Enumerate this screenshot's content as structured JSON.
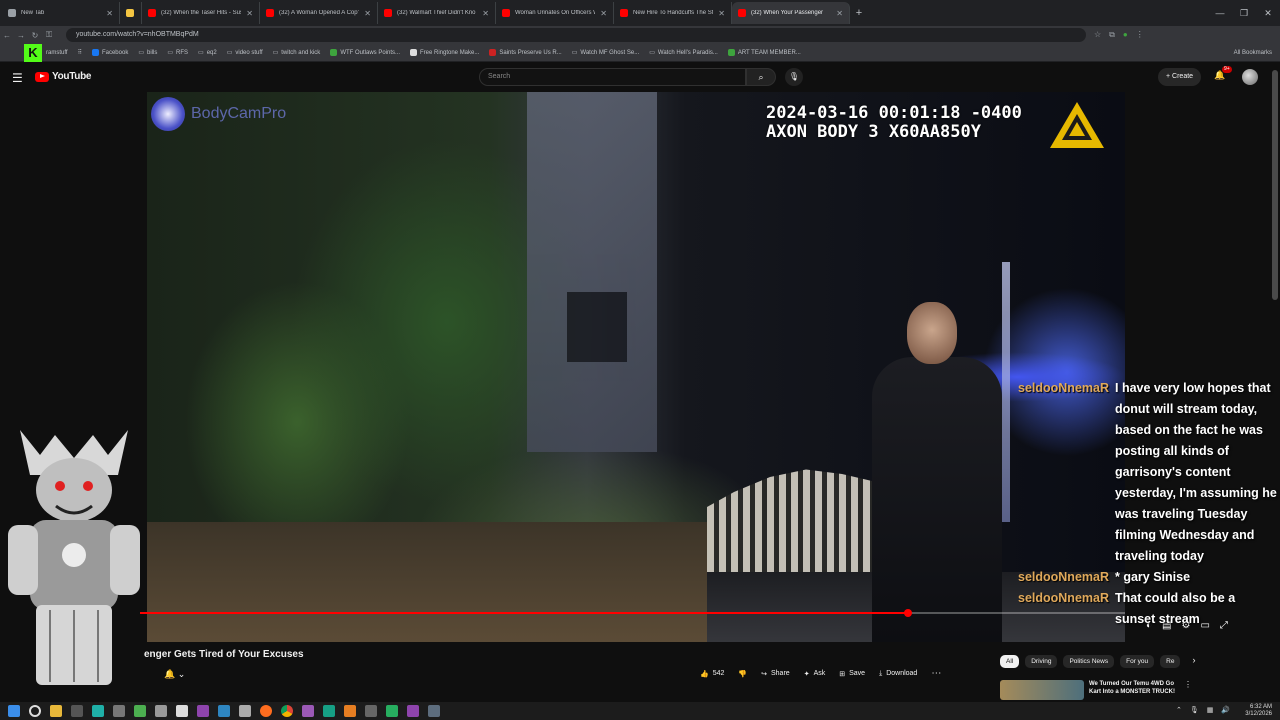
{
  "browser": {
    "tabs": [
      {
        "title": "New Tab",
        "color": "#9aa0a6",
        "active": false
      },
      {
        "title": "",
        "color": "#f4c542",
        "active": false
      },
      {
        "title": "(32) When the Taser Hits - Susp",
        "color": "#ff0000",
        "active": false
      },
      {
        "title": "(32) A Woman Opened A Cop's",
        "color": "#ff0000",
        "active": false
      },
      {
        "title": "(32) Walmart Thief Didn't Kno",
        "color": "#ff0000",
        "active": false
      },
      {
        "title": "Woman Urinates On Officers W",
        "color": "#ff0000",
        "active": false
      },
      {
        "title": "New Hire To Handcuffs The St",
        "color": "#ff0000",
        "active": false
      },
      {
        "title": "(32) When Your Passenger",
        "color": "#ff0000",
        "active": true
      }
    ],
    "tab_close": "✕",
    "new_tab": "+",
    "window_controls": [
      "—",
      "❐",
      "✕"
    ],
    "url": "youtube.com/watch?v=nhOBTMBqPdM",
    "bookmarks": [
      {
        "label": "Facebook",
        "color": "#1877f2"
      },
      {
        "label": "bills",
        "color": "#888"
      },
      {
        "label": "RFS",
        "color": "#888"
      },
      {
        "label": "eq2",
        "color": "#888"
      },
      {
        "label": "video stuff",
        "color": "#888"
      },
      {
        "label": "twitch and kick",
        "color": "#888"
      },
      {
        "label": "WTF Outlaws Points...",
        "color": "#3ea43e"
      },
      {
        "label": "Free Ringtone Make...",
        "color": "#ddd"
      },
      {
        "label": "Saints Preserve Us R...",
        "color": "#cc2222"
      },
      {
        "label": "Watch MF Ghost Se...",
        "color": "#888"
      },
      {
        "label": "Watch Hell's Paradis...",
        "color": "#888"
      },
      {
        "label": "ART TEAM MEMBER...",
        "color": "#3ea43e"
      }
    ],
    "bookmarks_all": "All Bookmarks",
    "overlay_text": "ramstuff"
  },
  "youtube": {
    "logo_text": "YouTube",
    "search_placeholder": "Search",
    "create_label": "Create",
    "notification_badge": "9+",
    "video_title": "enger Gets Tired of Your Excuses",
    "like_count": "542",
    "share_label": "Share",
    "ask_label": "Ask",
    "save_label": "Save",
    "download_label": "Download",
    "chips": [
      "All",
      "Driving",
      "Politics News",
      "For you",
      "Re"
    ],
    "reco_title": "We Turned Our Temu 4WD Go Kart Into a MONSTER TRUCK!",
    "progress": 0.78
  },
  "video": {
    "watermark": "BodyCamPro",
    "timestamp_line1": "2024-03-16 00:01:18 -0400",
    "timestamp_line2": "AXON BODY 3 X60AA850Y"
  },
  "chat": [
    {
      "user": "seldooNnemaR",
      "text": "I have very low hopes that donut will stream today, based on the fact he was posting all kinds of garrisony's content yesterday, I'm assuming he was traveling Tuesday filming Wednesday and traveling today"
    },
    {
      "user": "seldooNnemaR",
      "text": "* gary Sinise"
    },
    {
      "user": "seldooNnemaR",
      "text": "That could also be a sunset stream"
    }
  ],
  "taskbar": {
    "time": "6:32 AM",
    "date": "3/12/2026"
  },
  "colors": {
    "accent_red": "#ff0000",
    "chat_user": "#e0a95b"
  }
}
